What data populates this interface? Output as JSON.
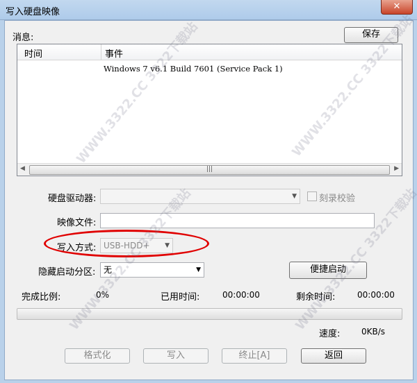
{
  "window": {
    "title": "写入硬盘映像",
    "close_label": "✕"
  },
  "messages": {
    "label": "消息:",
    "save_button": "保存",
    "columns": [
      "时间",
      "事件"
    ],
    "rows": [
      {
        "time": "",
        "event": "Windows 7 v6.1 Build 7601 (Service Pack 1)"
      }
    ],
    "scroll_left": "◀",
    "scroll_right": "▶",
    "scroll_grip": "|||"
  },
  "form": {
    "drive_label": "硬盘驱动器:",
    "drive_value": "",
    "verify_label": "刻录校验",
    "image_label": "映像文件:",
    "image_value": "",
    "write_mode_label": "写入方式:",
    "write_mode_value": "USB-HDD+",
    "hidden_partition_label": "隐藏启动分区:",
    "hidden_partition_value": "无",
    "quick_boot_button": "便捷启动",
    "dropdown_arrow": "▼"
  },
  "progress": {
    "complete_label": "完成比例:",
    "complete_value": "0%",
    "elapsed_label": "已用时间:",
    "elapsed_value": "00:00:00",
    "remaining_label": "剩余时间:",
    "remaining_value": "00:00:00",
    "speed_label": "速度:",
    "speed_value": "0KB/s",
    "fraction": 0
  },
  "actions": {
    "format": "格式化",
    "write": "写入",
    "abort": "终止[A]",
    "back": "返回"
  },
  "watermark": "WWW.3322.CC  3322下载站"
}
